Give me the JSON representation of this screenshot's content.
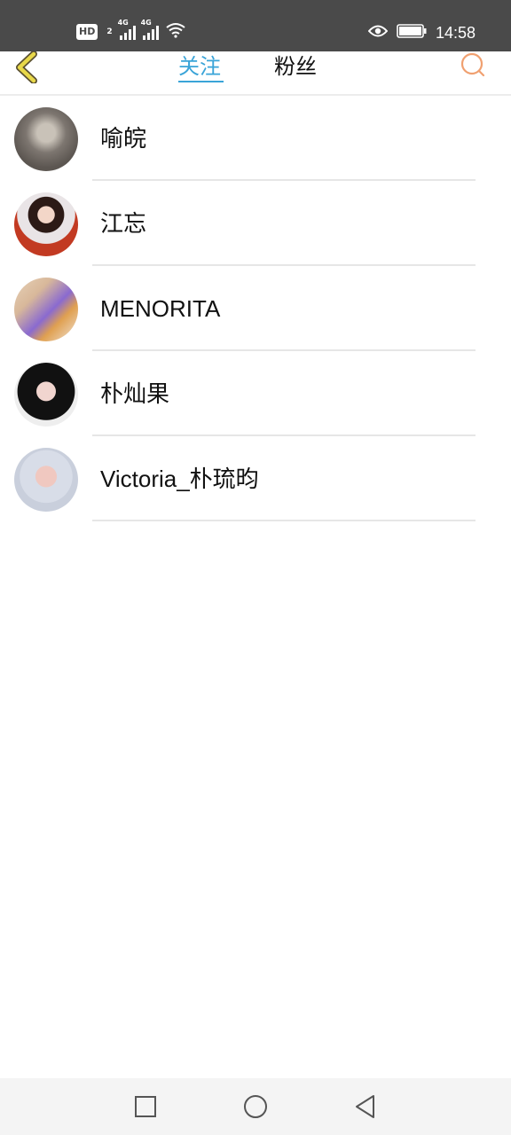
{
  "status_bar": {
    "hd_label": "HD",
    "hd_sub": "2",
    "network_1": "4G",
    "network_2": "4G",
    "time": "14:58",
    "icons": [
      "signal-icon",
      "signal-icon",
      "wifi-icon",
      "eye-icon",
      "battery-icon"
    ]
  },
  "header": {
    "back_icon": "chevron-left-icon",
    "tabs": [
      {
        "label": "关注",
        "active": true
      },
      {
        "label": "粉丝",
        "active": false
      }
    ],
    "search_icon": "search-icon",
    "colors": {
      "active_tab": "#3aa4d8",
      "back_icon": "#e8d84a",
      "search_icon": "#f0a070"
    }
  },
  "follow_list": [
    {
      "name": "喻皖",
      "avatar": "avatar-1"
    },
    {
      "name": "江忘",
      "avatar": "avatar-2"
    },
    {
      "name": "MENORITA",
      "avatar": "avatar-3"
    },
    {
      "name": "朴灿果",
      "avatar": "avatar-4"
    },
    {
      "name": "Victoria_朴琉昀",
      "avatar": "avatar-5"
    }
  ],
  "nav_bar": {
    "buttons": [
      "recent-apps-icon",
      "home-icon",
      "back-icon"
    ]
  }
}
